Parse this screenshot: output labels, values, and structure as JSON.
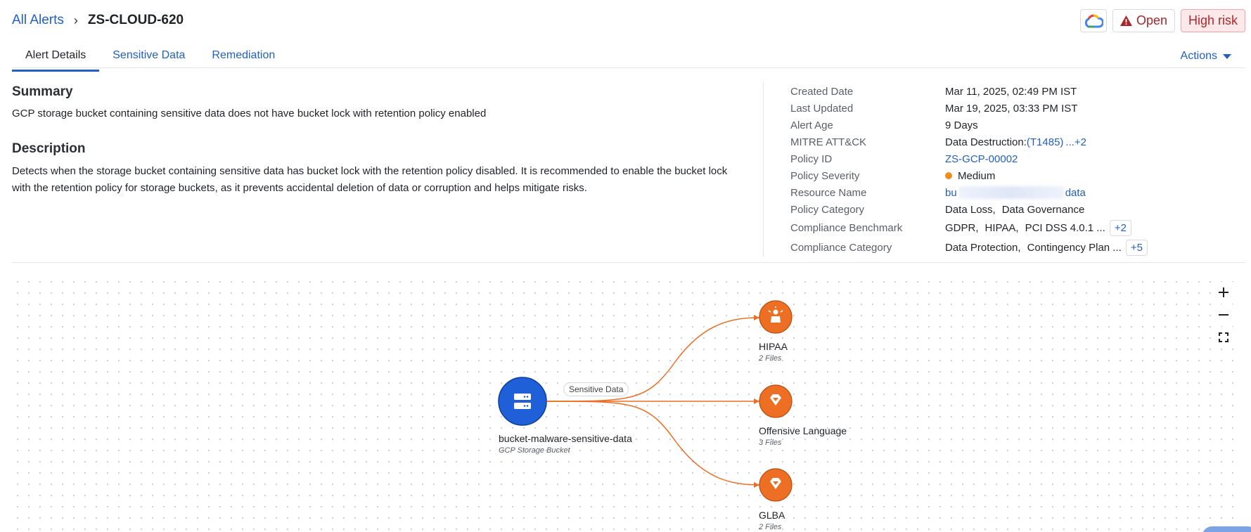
{
  "header": {
    "breadcrumb_root": "All Alerts",
    "alert_id": "ZS-CLOUD-620",
    "status_label": "Open",
    "risk_label": "High risk"
  },
  "tabs": [
    {
      "label": "Alert Details",
      "active": true
    },
    {
      "label": "Sensitive Data",
      "active": false
    },
    {
      "label": "Remediation",
      "active": false
    }
  ],
  "actions_label": "Actions",
  "summary": {
    "title": "Summary",
    "text": "GCP storage bucket containing sensitive data does not have bucket lock with retention policy enabled"
  },
  "description": {
    "title": "Description",
    "text": "Detects when the storage bucket containing sensitive data has bucket lock with the retention policy disabled. It is recommended to enable the bucket lock with the retention policy for storage buckets, as it prevents accidental deletion of data or corruption and helps mitigate risks."
  },
  "details": {
    "created_label": "Created Date",
    "created_value": "Mar 11, 2025, 02:49 PM IST",
    "updated_label": "Last Updated",
    "updated_value": "Mar 19, 2025, 03:33 PM IST",
    "age_label": "Alert Age",
    "age_value": "9 Days",
    "mitre_label": "MITRE ATT&CK",
    "mitre_prefix": "Data Destruction:",
    "mitre_code": "(T1485)",
    "mitre_more": "...+2",
    "policy_id_label": "Policy ID",
    "policy_id_value": "ZS-GCP-00002",
    "severity_label": "Policy Severity",
    "severity_value": "Medium",
    "resource_label": "Resource Name",
    "resource_start": "bu",
    "resource_end": "data",
    "category_label": "Policy Category",
    "category_value_1": "Data Loss,",
    "category_value_2": "Data Governance",
    "benchmark_label": "Compliance Benchmark",
    "benchmark_1": "GDPR,",
    "benchmark_2": "HIPAA,",
    "benchmark_3": "PCI DSS 4.0.1 ...",
    "benchmark_more": "+2",
    "ccat_label": "Compliance Category",
    "ccat_1": "Data Protection,",
    "ccat_2": "Contingency Plan ...",
    "ccat_more": "+5"
  },
  "graph": {
    "source": {
      "name": "bucket-malware-sensitive-data",
      "type": "GCP Storage Bucket"
    },
    "edge_label": "Sensitive Data",
    "targets": [
      {
        "name": "HIPAA",
        "files": "2 Files"
      },
      {
        "name": "Offensive Language",
        "files": "3 Files"
      },
      {
        "name": "GLBA",
        "files": "2 Files"
      }
    ],
    "colors": {
      "source": "#1f5fd8",
      "target": "#ec6f24",
      "edge": "#ec6f24"
    }
  }
}
